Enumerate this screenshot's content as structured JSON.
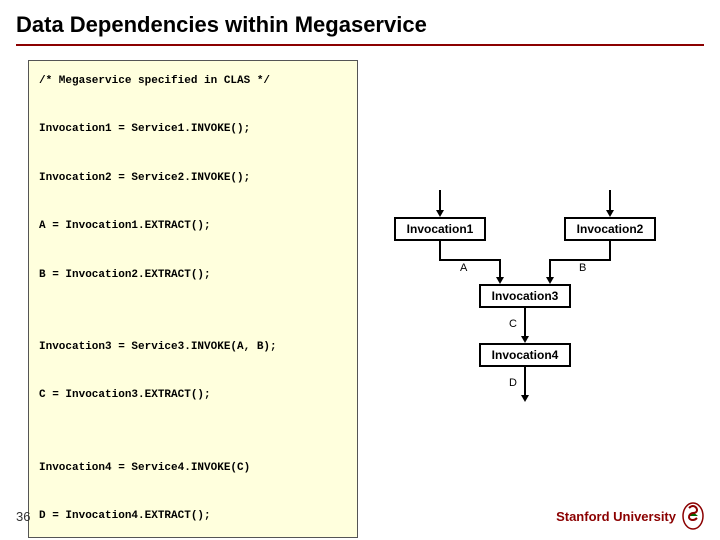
{
  "title": "Data Dependencies within Megaservice",
  "code": {
    "line1": "/* Megaservice specified in CLAS */",
    "line2": "Invocation1 = Service1.INVOKE();",
    "line3": "Invocation2 = Service2.INVOKE();",
    "line4": "A = Invocation1.EXTRACT();",
    "line5": "B = Invocation2.EXTRACT();",
    "line6": "Invocation3 = Service3.INVOKE(A, B);",
    "line7": "C = Invocation3.EXTRACT();",
    "line8": "Invocation4 = Service4.INVOKE(C)",
    "line9": "D = Invocation4.EXTRACT();"
  },
  "diagram": {
    "node1": "Invocation1",
    "node2": "Invocation2",
    "node3": "Invocation3",
    "node4": "Invocation4",
    "labelA": "A",
    "labelB": "B",
    "labelC": "C",
    "labelD": "D"
  },
  "footer": {
    "page": "36",
    "brand": "Stanford University"
  }
}
